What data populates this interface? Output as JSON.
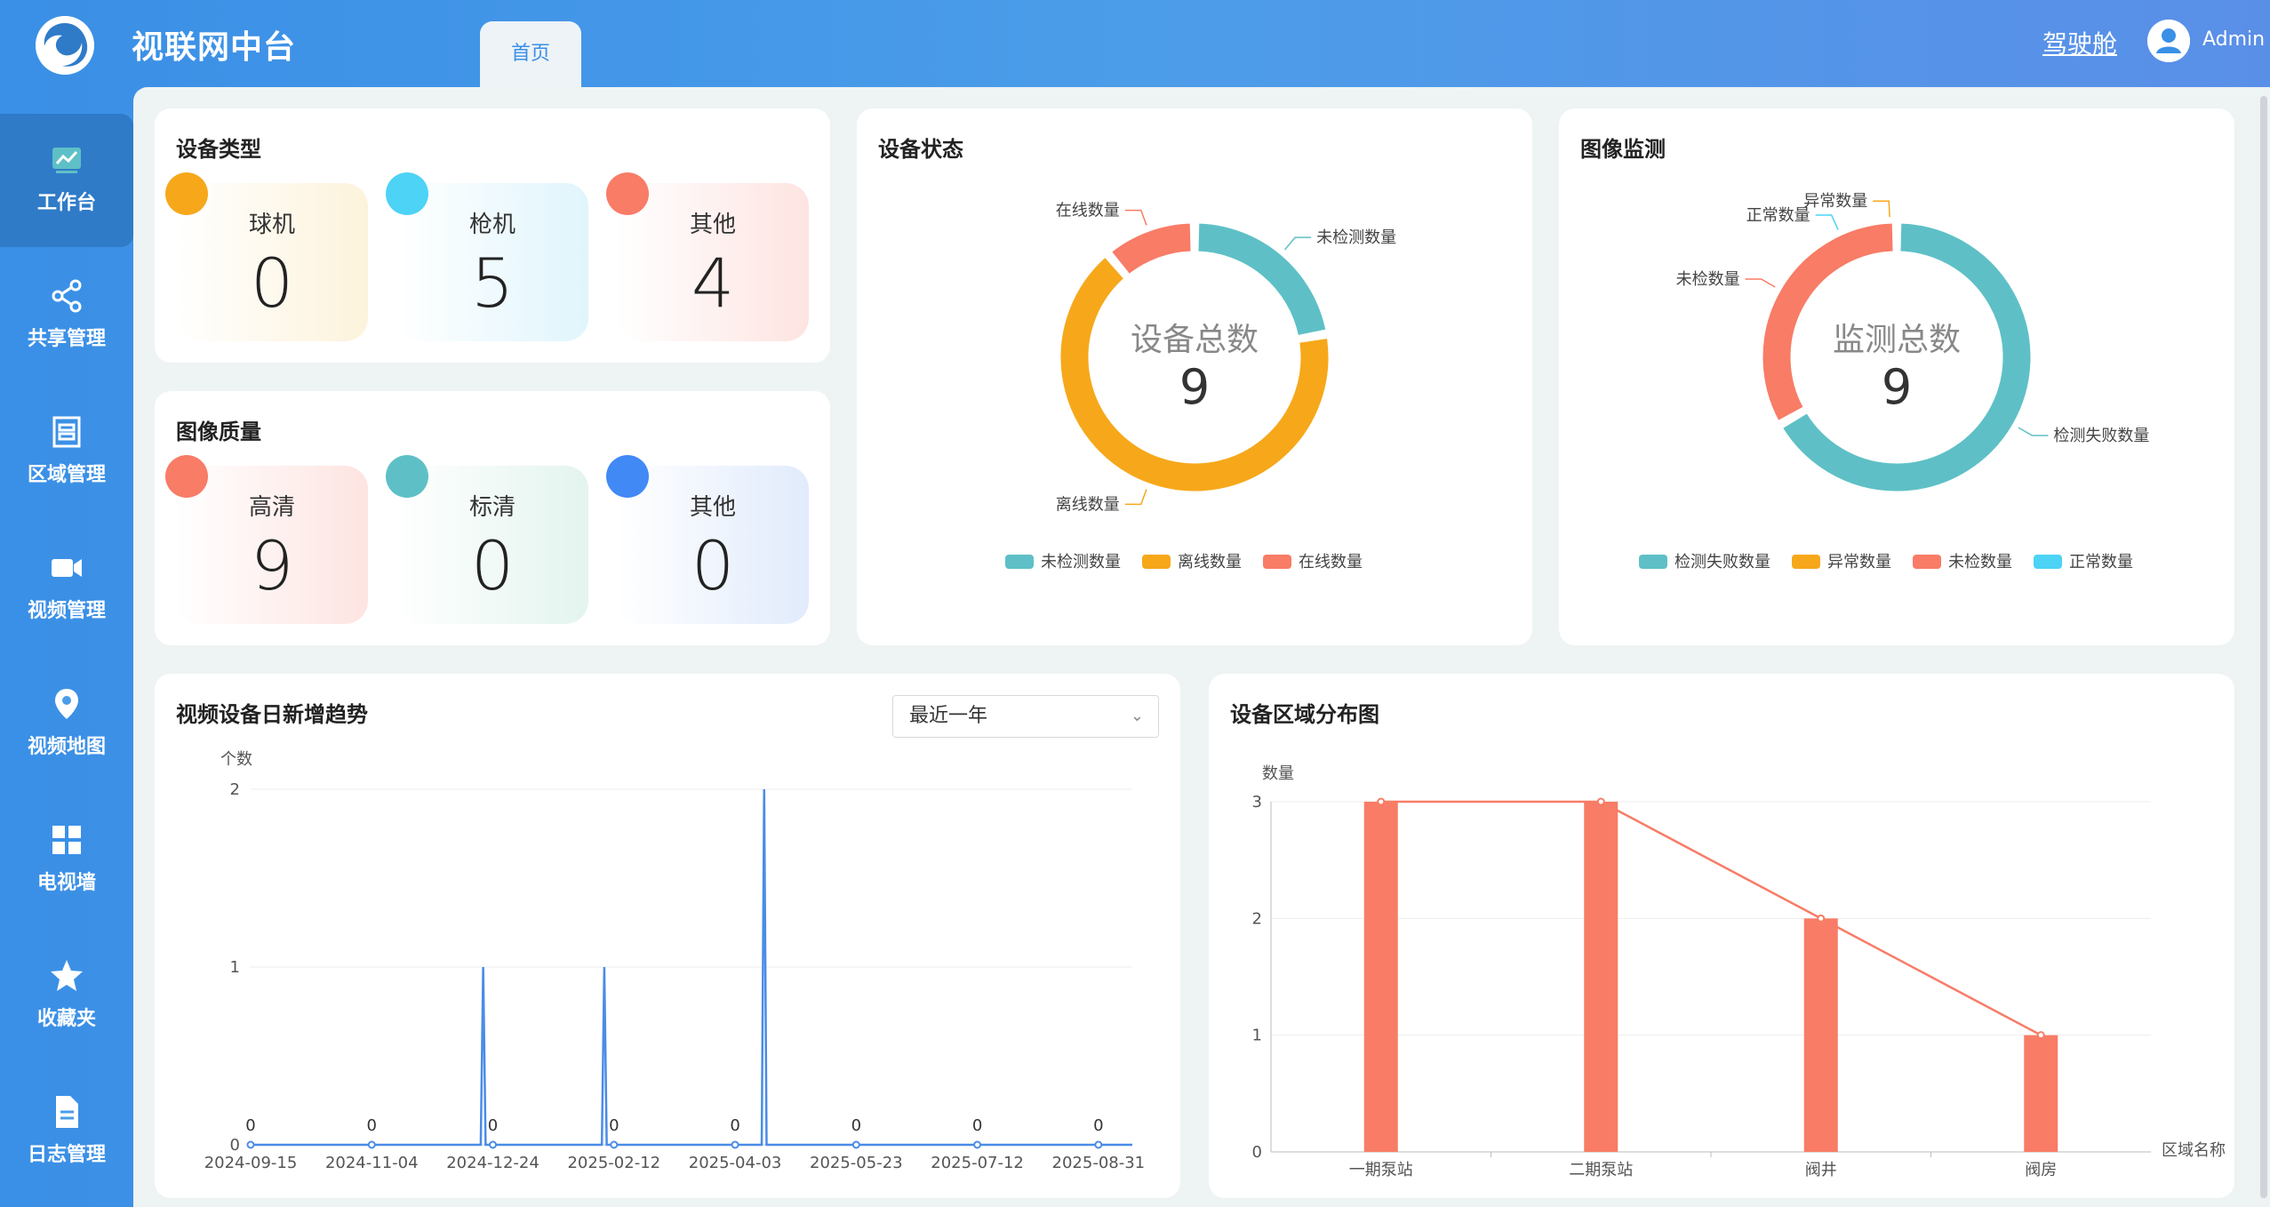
{
  "header": {
    "title": "视联网中台",
    "tab": "首页",
    "cockpit": "驾驶舱",
    "user": "Admin"
  },
  "sidebar": {
    "items": [
      {
        "label": "工作台",
        "icon": "chart-icon",
        "active": true
      },
      {
        "label": "共享管理",
        "icon": "share-icon"
      },
      {
        "label": "区域管理",
        "icon": "region-icon"
      },
      {
        "label": "视频管理",
        "icon": "video-camera-icon"
      },
      {
        "label": "视频地图",
        "icon": "map-pin-icon"
      },
      {
        "label": "电视墙",
        "icon": "grid-icon"
      },
      {
        "label": "收藏夹",
        "icon": "star-icon"
      },
      {
        "label": "日志管理",
        "icon": "document-icon"
      }
    ]
  },
  "device_type": {
    "title": "设备类型",
    "items": [
      {
        "label": "球机",
        "value": "0",
        "color": "#f6a81a"
      },
      {
        "label": "枪机",
        "value": "5",
        "color": "#4cd3f5"
      },
      {
        "label": "其他",
        "value": "4",
        "color": "#f87c66"
      }
    ]
  },
  "image_quality": {
    "title": "图像质量",
    "items": [
      {
        "label": "高清",
        "value": "9",
        "color": "#f87c66"
      },
      {
        "label": "标清",
        "value": "0",
        "color": "#5ec0c6"
      },
      {
        "label": "其他",
        "value": "0",
        "color": "#4189f5"
      }
    ]
  },
  "device_status": {
    "title": "设备状态",
    "center_label": "设备总数",
    "center_value": "9",
    "legend": [
      "未检测数量",
      "离线数量",
      "在线数量"
    ]
  },
  "image_monitor": {
    "title": "图像监测",
    "center_label": "监测总数",
    "center_value": "9",
    "legend": [
      "检测失败数量",
      "异常数量",
      "未检数量",
      "正常数量"
    ]
  },
  "trend": {
    "title": "视频设备日新增趋势",
    "select_value": "最近一年",
    "ylabel": "个数"
  },
  "region": {
    "title": "设备区域分布图",
    "ylabel": "数量",
    "xlabel": "区域名称"
  },
  "chart_data": [
    {
      "type": "pie",
      "title": "设备状态",
      "labels": [
        "未检测数量",
        "离线数量",
        "在线数量"
      ],
      "values": [
        2,
        6,
        1
      ],
      "colors": [
        "#5ec0c6",
        "#f6a81a",
        "#f87c66"
      ]
    },
    {
      "type": "pie",
      "title": "图像监测",
      "labels": [
        "检测失败数量",
        "异常数量",
        "未检数量",
        "正常数量"
      ],
      "values": [
        6,
        0,
        3,
        0
      ],
      "colors": [
        "#5ec0c6",
        "#f6a81a",
        "#f87c66",
        "#4cd3f5"
      ]
    },
    {
      "type": "line",
      "title": "视频设备日新增趋势",
      "ylabel": "个数",
      "ylim": [
        0,
        2
      ],
      "yticks": [
        0,
        1,
        2
      ],
      "xticks": [
        "2024-09-15",
        "2024-11-04",
        "2024-12-24",
        "2025-02-12",
        "2025-04-03",
        "2025-05-23",
        "2025-07-12",
        "2025-08-31"
      ],
      "x_range": [
        "2024-09-15",
        "2025-09-14"
      ],
      "labeled_points": {
        "x": [
          "2024-09-15",
          "2024-11-04",
          "2024-12-24",
          "2025-02-12",
          "2025-04-03",
          "2025-05-23",
          "2025-07-12",
          "2025-08-31"
        ],
        "y": [
          0,
          0,
          0,
          0,
          0,
          0,
          0,
          0
        ]
      },
      "spikes": [
        {
          "x": "2024-12-20",
          "y": 1
        },
        {
          "x": "2025-02-08",
          "y": 1
        },
        {
          "x": "2025-04-15",
          "y": 2
        }
      ]
    },
    {
      "type": "bar",
      "title": "设备区域分布图",
      "xlabel": "区域名称",
      "ylabel": "数量",
      "categories": [
        "一期泵站",
        "二期泵站",
        "阀井",
        "阀房"
      ],
      "values": [
        3,
        3,
        2,
        1
      ],
      "ylim": [
        0,
        3
      ],
      "yticks": [
        0,
        1,
        2,
        3
      ],
      "line_overlay": true,
      "color": "#f87c66"
    }
  ]
}
